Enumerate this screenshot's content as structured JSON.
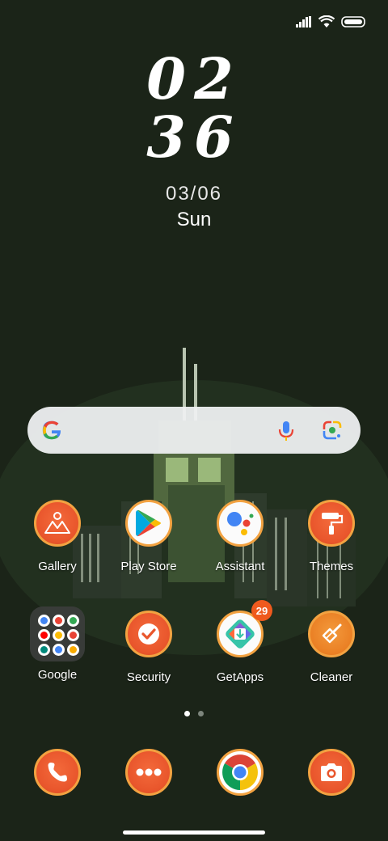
{
  "colors": {
    "background": "#1b2418",
    "icon_orange": "#e9562c",
    "icon_ring": "#f2a241",
    "badge": "#ef5a1e"
  },
  "status_bar": {
    "signal_icon": "signal-icon",
    "wifi_icon": "wifi-icon",
    "battery_icon": "battery-icon"
  },
  "clock": {
    "hours": "02",
    "minutes": "36"
  },
  "date": {
    "date": "03/06",
    "day": "Sun"
  },
  "search_bar": {
    "logo_icon": "google-g-icon",
    "mic_icon": "microphone-icon",
    "lens_icon": "google-lens-icon"
  },
  "apps_row1": [
    {
      "label": "Gallery",
      "icon": "gallery-icon"
    },
    {
      "label": "Play Store",
      "icon": "play-store-icon"
    },
    {
      "label": "Assistant",
      "icon": "assistant-icon"
    },
    {
      "label": "Themes",
      "icon": "paint-roller-icon"
    }
  ],
  "apps_row2": [
    {
      "label": "Google",
      "icon": "folder-icon"
    },
    {
      "label": "Security",
      "icon": "shield-check-icon"
    },
    {
      "label": "GetApps",
      "icon": "download-icon",
      "badge": "29"
    },
    {
      "label": "Cleaner",
      "icon": "broom-icon"
    }
  ],
  "dock": [
    {
      "icon": "phone-icon"
    },
    {
      "icon": "messages-icon"
    },
    {
      "icon": "chrome-icon"
    },
    {
      "icon": "camera-icon"
    }
  ],
  "pages": {
    "count": 2,
    "active": 1
  }
}
